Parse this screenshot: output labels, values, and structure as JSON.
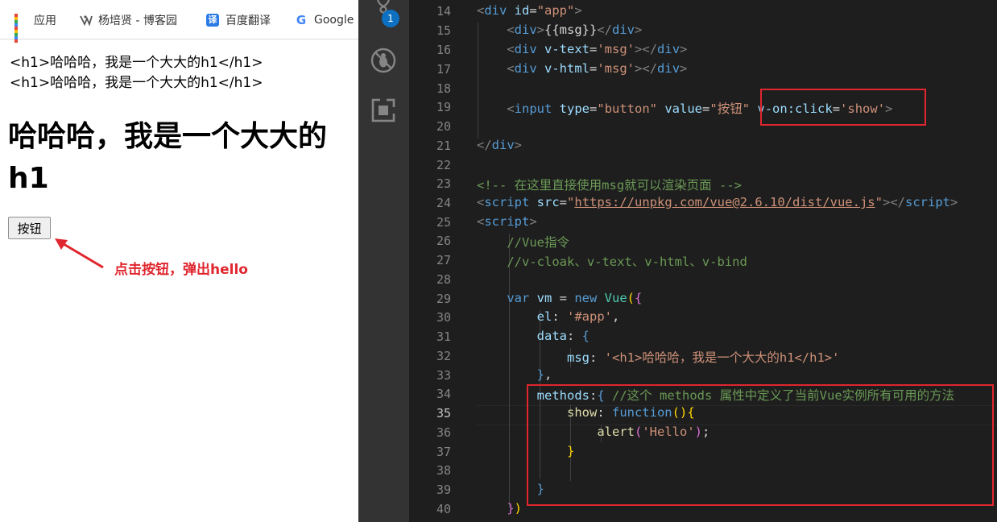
{
  "browser": {
    "bookmarks": [
      {
        "label": "应用",
        "icon": "apps-grid-icon"
      },
      {
        "label": "杨培贤 - 博客园",
        "icon": "cnblogs-icon"
      },
      {
        "label": "百度翻译",
        "icon": "baidu-fanyi-icon",
        "glyph": "译"
      },
      {
        "label": "Google",
        "icon": "google-icon",
        "glyph": "G"
      }
    ],
    "page": {
      "text_line_1": "<h1>哈哈哈，我是一个大大的h1</h1>",
      "text_line_2": "<h1>哈哈哈，我是一个大大的h1</h1>",
      "heading": "哈哈哈，我是一个大大的h1",
      "button_label": "按钮"
    },
    "annotation": "点击按钮，弹出hello",
    "annotation_color": "#e0262e"
  },
  "activity_bar": {
    "items": [
      "source-control-icon",
      "debug-icon",
      "extensions-icon"
    ],
    "badge": "1",
    "badge_color": "#0e70c0"
  },
  "editor": {
    "current_line": 35,
    "line_numbers": [
      "14",
      "15",
      "16",
      "17",
      "18",
      "19",
      "20",
      "21",
      "22",
      "23",
      "24",
      "25",
      "26",
      "27",
      "28",
      "29",
      "30",
      "31",
      "32",
      "33",
      "34",
      "35",
      "36",
      "37",
      "38",
      "39",
      "40"
    ],
    "code": {
      "l14": {
        "open": "<",
        "tag": "div",
        "attr": " id",
        "eq": "=",
        "val": "\"app\"",
        "close": ">"
      },
      "l15": {
        "open": "<",
        "tag": "div",
        "gt": ">",
        "text": "{{msg}}",
        "endopen": "</",
        "endtag": "div",
        "close": ">"
      },
      "l16": {
        "open": "<",
        "tag": "div",
        "attr": " v-text",
        "eq": "=",
        "val": "'msg'",
        "gt": ">",
        "endopen": "</",
        "endtag": "div",
        "close": ">"
      },
      "l17": {
        "open": "<",
        "tag": "div",
        "attr": " v-html",
        "eq": "=",
        "val": "'msg'",
        "gt": ">",
        "endopen": "</",
        "endtag": "div",
        "close": ">"
      },
      "l19": {
        "open": "<",
        "tag": "input",
        "attr1": " type",
        "eq1": "=",
        "val1": "\"button\"",
        "attr2": " value",
        "eq2": "=",
        "val2": "\"按钮\"",
        "attr3": " v-on:click",
        "eq3": "=",
        "val3": "'show'",
        "close": ">"
      },
      "l21": {
        "endopen": "</",
        "endtag": "div",
        "close": ">"
      },
      "l23": "<!-- 在这里直接使用msg就可以渲染页面 -->",
      "l24": {
        "open": "<",
        "tag": "script",
        "attr": " src",
        "eq": "=",
        "q1": "\"",
        "url": "https://unpkg.com/vue@2.6.10/dist/vue.js",
        "q2": "\"",
        "gt": ">",
        "endopen": "</",
        "endtag": "script",
        "close": ">"
      },
      "l25": {
        "open": "<",
        "tag": "script",
        "close": ">"
      },
      "l26": "//Vue指令",
      "l27": "//v-cloak、v-text、v-html、v-bind",
      "l29": {
        "kw": "var",
        "ident": " vm ",
        "op": "= ",
        "new": "new",
        "cls": " Vue",
        "paren": "(",
        "brace": "{"
      },
      "l30": {
        "key": "el",
        "colon": ": ",
        "val": "'#app'",
        "comma": ","
      },
      "l31": {
        "key": "data",
        "colon": ": ",
        "brace": "{"
      },
      "l32": {
        "key": "msg",
        "colon": ": ",
        "val": "'<h1>哈哈哈，我是一个大大的h1</h1>'"
      },
      "l33": {
        "brace": "}",
        "comma": ","
      },
      "l34": {
        "key": "methods",
        "colon": ":",
        "brace": "{",
        "comment": " //这个 methods 属性中定义了当前Vue实例所有可用的方法"
      },
      "l35": {
        "key": "show",
        "colon": ": ",
        "kw": "function",
        "paren": "()",
        "brace": "{"
      },
      "l36": {
        "fn": "alert",
        "paren1": "(",
        "str": "'Hello'",
        "paren2": ")",
        "semi": ";"
      },
      "l37": "}",
      "l39": "}",
      "l40": {
        "brace": "}",
        "paren": ")"
      }
    }
  }
}
